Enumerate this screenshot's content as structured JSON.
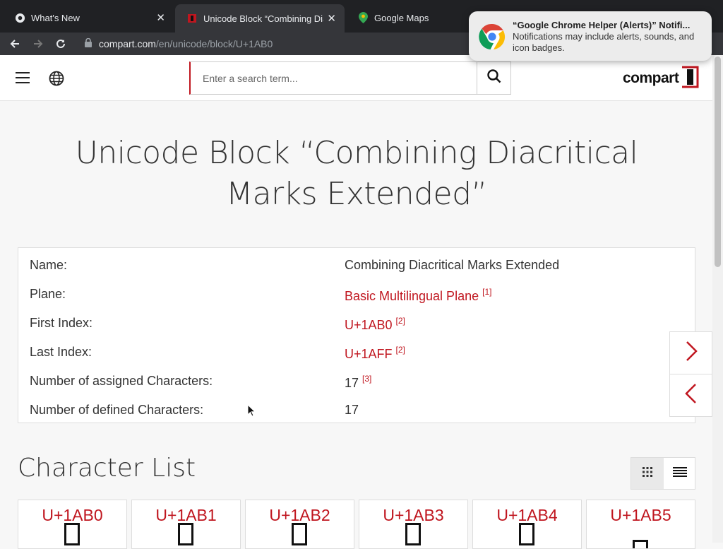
{
  "browser": {
    "tabs": [
      {
        "title": "What's New",
        "icon": "chrome-icon"
      },
      {
        "title": "Unicode Block “Combining Dia",
        "icon": "compart-favicon"
      },
      {
        "title": "Google Maps",
        "icon": "google-maps-icon"
      }
    ],
    "url_host": "compart.com",
    "url_path": "/en/unicode/block/U+1AB0"
  },
  "notification": {
    "title": "“Google Chrome Helper (Alerts)” Notifi...",
    "body": "Notifications may include alerts, sounds, and icon badges."
  },
  "header": {
    "search_placeholder": "Enter a search term...",
    "logo_text": "compart"
  },
  "page": {
    "title": "Unicode Block “Combining Diacritical Marks Extended”",
    "info": [
      {
        "label": "Name:",
        "value": "Combining Diacritical Marks Extended",
        "ref": ""
      },
      {
        "label": "Plane:",
        "value": "Basic Multilingual Plane",
        "ref": "[1]"
      },
      {
        "label": "First Index:",
        "value": "U+1AB0",
        "ref": "[2]"
      },
      {
        "label": "Last Index:",
        "value": "U+1AFF",
        "ref": "[2]"
      },
      {
        "label": "Number of assigned Characters:",
        "value": "17",
        "ref": "[3]"
      },
      {
        "label": "Number of defined Characters:",
        "value": "17",
        "ref": ""
      }
    ],
    "section_title": "Character List",
    "characters": [
      "U+1AB0",
      "U+1AB1",
      "U+1AB2",
      "U+1AB3",
      "U+1AB4",
      "U+1AB5"
    ]
  },
  "colors": {
    "accent": "#c0161f",
    "text": "#333333"
  }
}
